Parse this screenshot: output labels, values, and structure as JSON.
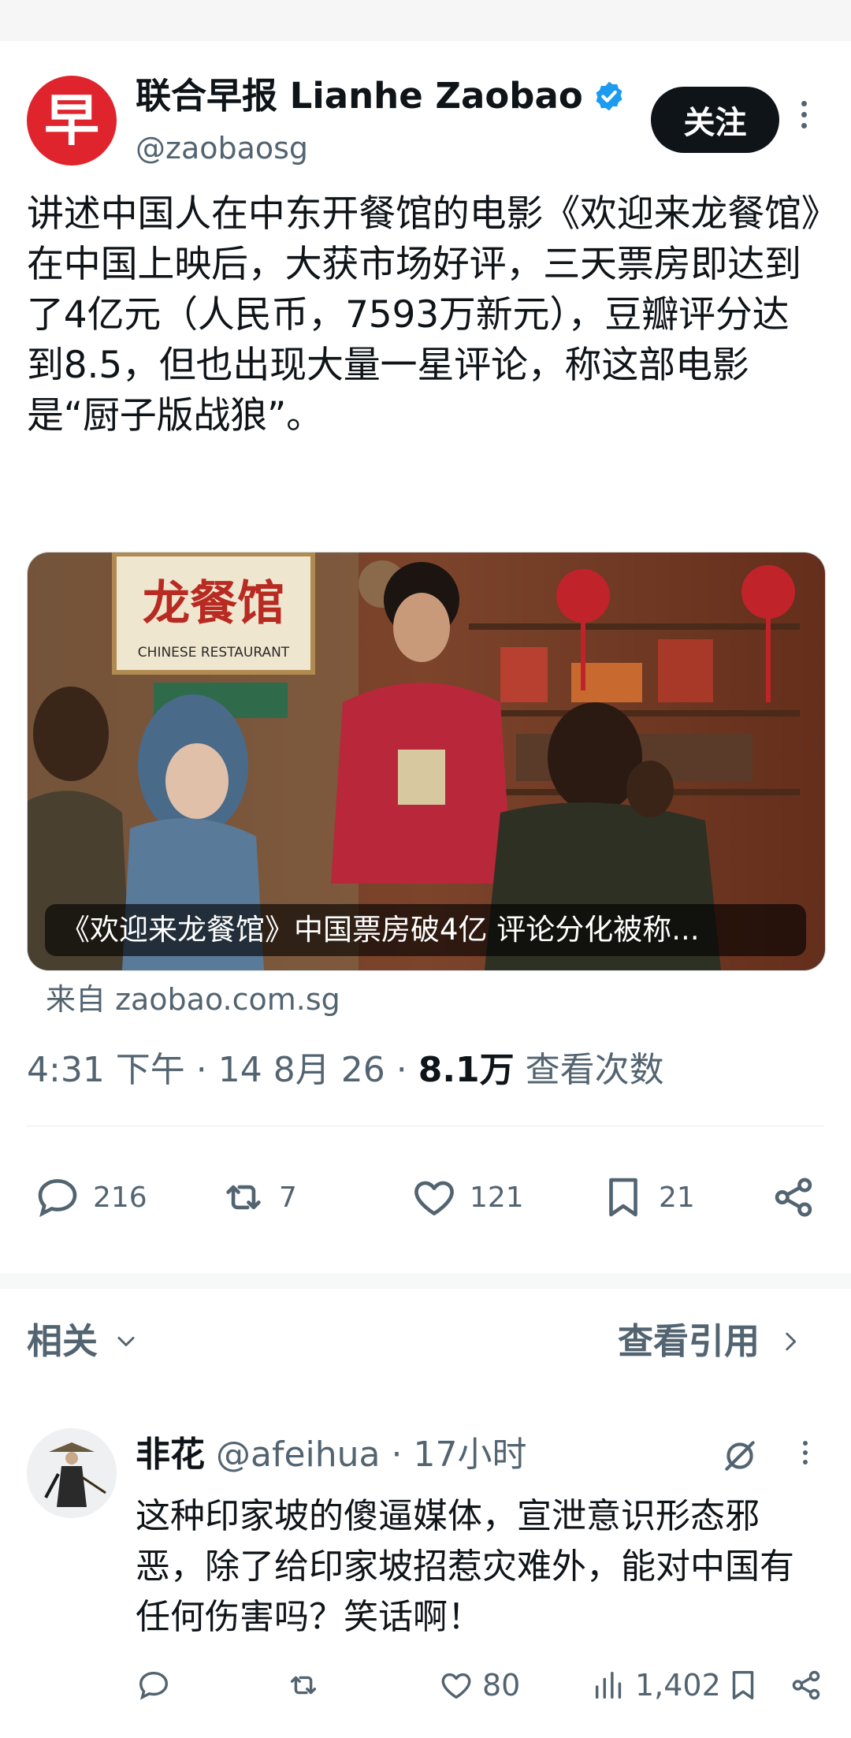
{
  "tweet": {
    "author_name": "联合早报 Lianhe Zaobao",
    "handle": "@zaobaosg",
    "avatar_char": "早",
    "follow_label": "关注",
    "text": "讲述中国人在中东开餐馆的电影《欢迎来龙餐馆》在中国上映后，大获市场好评，三天票房即达到了4亿元（人民币，7593万新元），豆瓣评分达到8.5，但也出现大量一星评论，称这部电影是“厨子版战狼”。",
    "media": {
      "sign_main": "龙餐馆",
      "sign_sub": "CHINESE RESTAURANT",
      "caption": "《欢迎来龙餐馆》中国票房破4亿 评论分化被称..."
    },
    "source_label": "来自 zaobao.com.sg",
    "time": "4:31 下午",
    "date": "14 8月 26",
    "views_count": "8.1万",
    "views_label": "查看次数",
    "stats": {
      "replies": "216",
      "retweets": "7",
      "likes": "121",
      "bookmarks": "21"
    }
  },
  "related": {
    "label": "相关",
    "view_quotes_label": "查看引用"
  },
  "reply": {
    "name": "非花",
    "handle": "@afeihua",
    "time": "17小时",
    "text": "这种印家坡的傻逼媒体，宣泄意识形态邪恶，除了给印家坡招惹灾难外，能对中国有任何伤害吗？笑话啊！",
    "stats": {
      "likes": "80",
      "views": "1,402"
    }
  },
  "colors": {
    "brand_red": "#e0242e",
    "verified_blue": "#1d9bf0",
    "muted": "#536471",
    "text": "#0f1419"
  }
}
